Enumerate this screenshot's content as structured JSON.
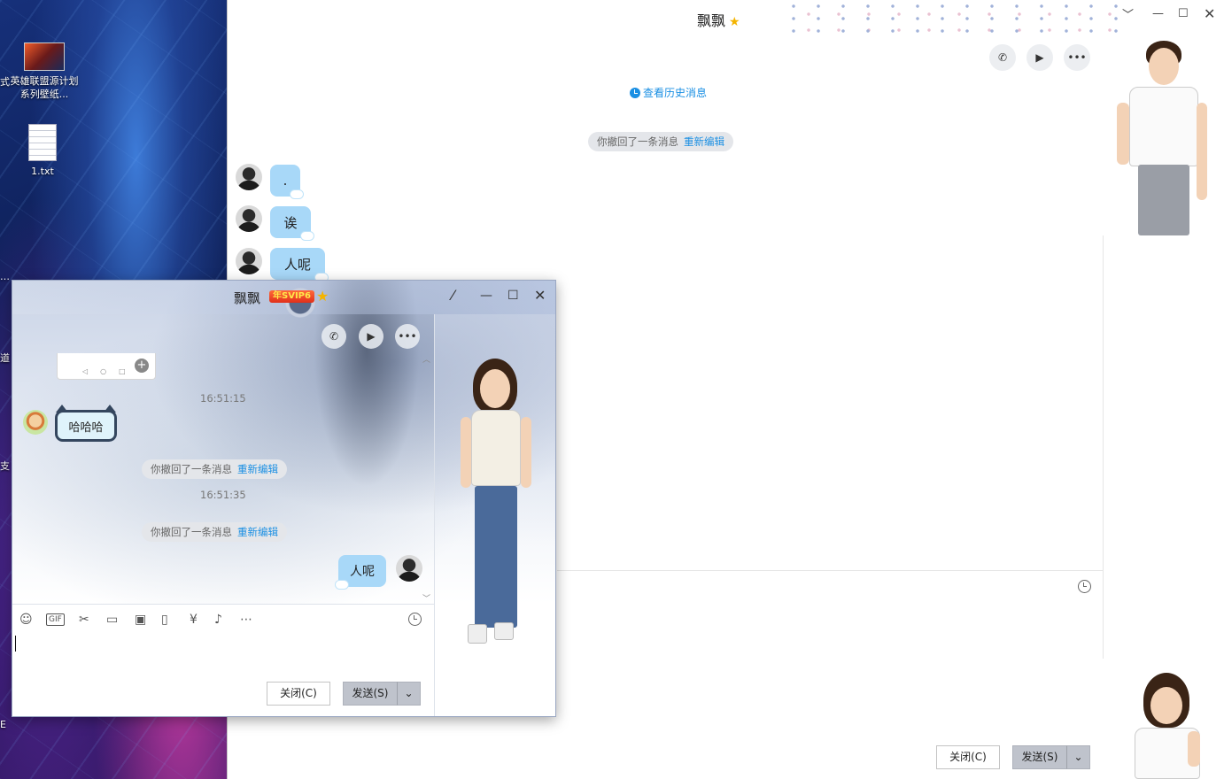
{
  "desktop": {
    "icons": [
      {
        "label": "英雄联盟源计划系列壁纸..."
      },
      {
        "label": "1.txt"
      }
    ],
    "edge_chars": [
      "式",
      "…",
      "道",
      "支",
      "E"
    ]
  },
  "main_window": {
    "title": "飘飘",
    "history_link": "查看历史消息",
    "recall_text": "你撤回了一条消息",
    "reedit_link": "重新编辑",
    "messages": [
      ".",
      "诶",
      "人呢"
    ],
    "close_button": "关闭(C)",
    "send_button": "发送(S)"
  },
  "small_window": {
    "title": "飘飘",
    "vip_badge": "年SVIP6",
    "timestamps": [
      "16:51:15",
      "16:51:35"
    ],
    "received_message": "哈哈哈",
    "recall_text": "你撤回了一条消息",
    "reedit_link": "重新编辑",
    "sent_message": "人呢",
    "close_button": "关闭(C)",
    "send_button": "发送(S)"
  },
  "icons": {
    "phone": "phone-icon",
    "video": "video-icon",
    "more": "more-icon",
    "history": "clock-icon",
    "emoji": "emoji-icon",
    "gif": "gif-icon",
    "scissors": "scissors-icon",
    "folder": "folder-icon",
    "image": "image-icon",
    "shake": "shake-icon",
    "red_packet": "red-packet-icon",
    "music": "music-icon",
    "more_tools": "more-tools-icon"
  },
  "colors": {
    "accent": "#1a8fe3",
    "bubble": "#a8d8f8",
    "send_button": "#bfc3cc"
  }
}
